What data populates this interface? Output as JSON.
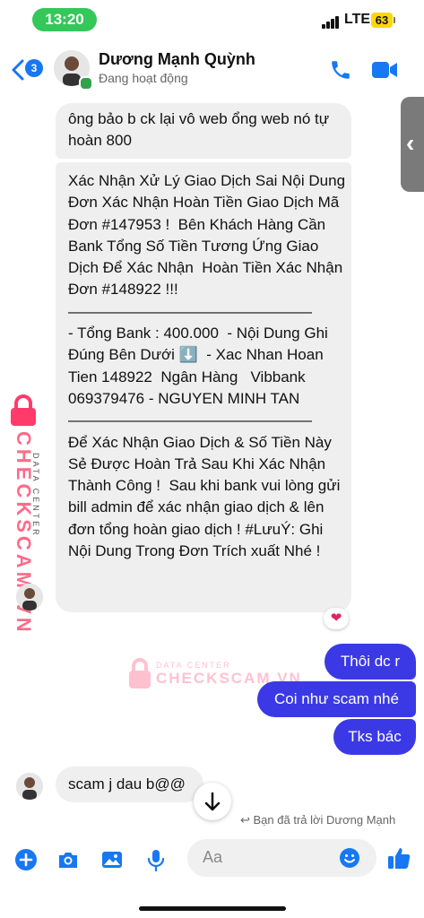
{
  "status_bar": {
    "time": "13:20",
    "network": "LTE",
    "battery": "63"
  },
  "header": {
    "back_badge": "3",
    "contact_name": "Dương Mạnh Quỳnh",
    "presence": "Đang hoạt động"
  },
  "messages": {
    "incoming_1": "ông bảo b ck lại vô web ổng web nó tự hoàn 800",
    "incoming_2": "Xác Nhận Xử Lý Giao Dịch Sai Nội Dung Đơn Xác Nhận Hoàn Tiền Giao Dịch Mã Đơn #147953 !  Bên Khách Hàng Cần Bank Tổng Số Tiền Tương Ứng Giao Dịch Để Xác Nhận  Hoàn Tiền Xác Nhận Đơn #148922 !!!\n————————————————\n- Tổng Bank : 400.000  - Nội Dung Ghi Đúng Bên Dưới ⬇️  - Xac Nhan Hoan Tien 148922  Ngân Hàng   Vibbank 069379476 - NGUYEN MINH TAN\n————————————————\nĐể Xác Nhận Giao Dịch & Số Tiền Này Sẻ Được Hoàn Trả Sau Khi Xác Nhận Thành Công !  Sau khi bank vui lòng gửi bill admin để xác nhận giao dịch & lên đơn tổng hoàn giao dịch ! #LưuÝ: Ghi Nội Dung Trong Đơn Trích xuất Nhé !",
    "reaction": "❤",
    "outgoing_1": "Thôi dc r",
    "outgoing_2": "Coi như scam nhé",
    "outgoing_3": "Tks bác",
    "incoming_3": "scam j dau b@@",
    "replied_note": "Bạn đã trả lời Dương Mạnh"
  },
  "composer": {
    "placeholder": "Aa"
  },
  "watermark": {
    "brand": "CHECKSCAM.VN",
    "tagline": "DATA CENTER"
  },
  "colors": {
    "accent": "#1877f2",
    "outgoing_bubble": "#3b39e6",
    "incoming_bubble": "#efefef",
    "watermark": "#ff6b8a"
  }
}
